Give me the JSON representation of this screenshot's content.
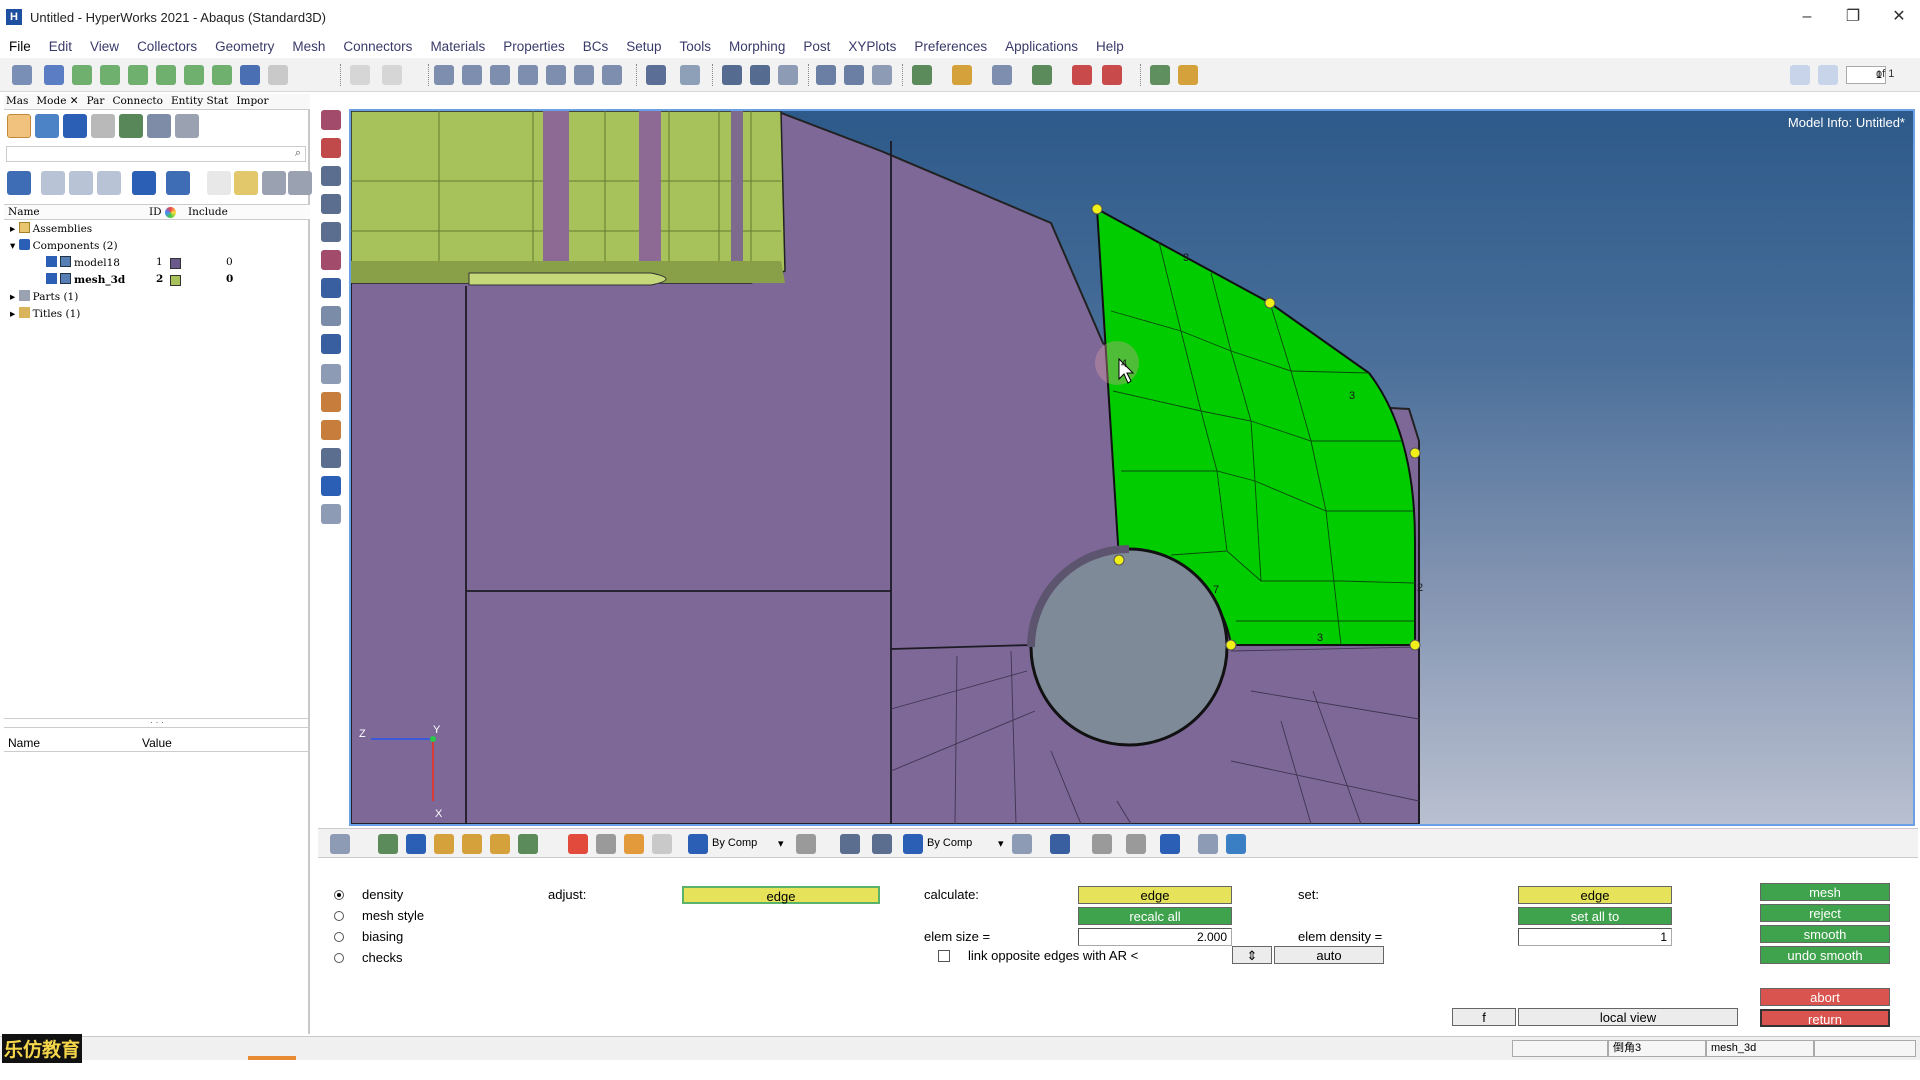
{
  "window": {
    "title": "Untitled - HyperWorks 2021 - Abaqus (Standard3D)",
    "app_icon": "H",
    "controls": [
      "–",
      "❐",
      "✕"
    ]
  },
  "menu": [
    "File",
    "Edit",
    "View",
    "Collectors",
    "Geometry",
    "Mesh",
    "Connectors",
    "Materials",
    "Properties",
    "BCs",
    "Setup",
    "Tools",
    "Morphing",
    "Post",
    "XYPlots",
    "Preferences",
    "Applications",
    "Help"
  ],
  "page": {
    "current": "1",
    "of": "of 1"
  },
  "browser": {
    "tabs": [
      "Mas",
      "Mode ✕",
      "Par",
      "Connecto",
      "Entity Stat",
      "Impor"
    ],
    "tree_columns": {
      "name": "Name",
      "id": "ID",
      "include": "Include"
    },
    "tree": [
      {
        "label": "Assemblies",
        "id": "",
        "include": ""
      },
      {
        "label": "Components (2)",
        "id": "",
        "include": ""
      },
      {
        "label": "model18",
        "id": "1",
        "include": "0",
        "color": "#6a5a8c"
      },
      {
        "label": "mesh_3d",
        "id": "2",
        "include": "0",
        "color": "#a7c25a"
      },
      {
        "label": "Parts (1)",
        "id": "",
        "include": ""
      },
      {
        "label": "Titles (1)",
        "id": "",
        "include": ""
      }
    ],
    "props_columns": {
      "name": "Name",
      "value": "Value"
    }
  },
  "viewport": {
    "model_info": "Model Info: Untitled*",
    "edge_numbers": [
      "3",
      "3",
      "4",
      "7",
      "2",
      "3"
    ],
    "triad": {
      "z": "Z",
      "y": "Y",
      "x": "X"
    }
  },
  "bottom_toolbar": {
    "bycomp1": "By Comp",
    "bycomp2": "By Comp"
  },
  "panel": {
    "radios": [
      {
        "label": "density",
        "selected": true
      },
      {
        "label": "mesh style",
        "selected": false
      },
      {
        "label": "biasing",
        "selected": false
      },
      {
        "label": "checks",
        "selected": false
      }
    ],
    "adjust_label": "adjust:",
    "adjust_value": "edge",
    "calculate_label": "calculate:",
    "calculate_value": "edge",
    "recalc_all": "recalc all",
    "elem_size_label": "elem size =",
    "elem_size_value": "2.000",
    "link_label": "link opposite edges with AR <",
    "link_arrow": "⇕",
    "link_value": "auto",
    "set_label": "set:",
    "set_value": "edge",
    "set_all_to": "set all to",
    "elem_density_label": "elem density =",
    "elem_density_value": "1",
    "mesh": "mesh",
    "reject": "reject",
    "smooth": "smooth",
    "undo_smooth": "undo smooth",
    "abort": "abort",
    "return": "return",
    "f_button": "f",
    "local_view": "local view"
  },
  "status": {
    "field1": "倒角3",
    "field2": "mesh_3d"
  },
  "watermark": "乐仿教育",
  "colors": {
    "mesh_green": "#00cc00",
    "model_purple": "#7d6898",
    "mesh_olive": "#a7c25a",
    "node_yellow": "#f0f018",
    "button_yellow": "#e6e35a",
    "button_green": "#3fa34d",
    "button_red": "#d9534f"
  }
}
